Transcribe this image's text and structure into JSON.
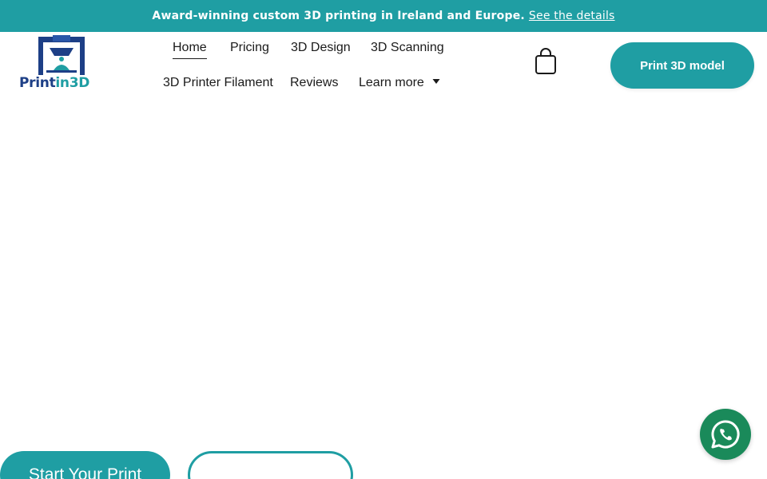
{
  "announcement": {
    "text": "Award-winning custom 3D printing in Ireland and Europe.",
    "link_label": "See the details"
  },
  "logo": {
    "text_part1": "Print",
    "text_part2": "in3D",
    "icon": "3d-printer-icon"
  },
  "nav": {
    "items": [
      {
        "label": "Home",
        "active": true
      },
      {
        "label": "Pricing"
      },
      {
        "label": "3D Design"
      },
      {
        "label": "3D Scanning"
      },
      {
        "label": "3D Printer Filament"
      },
      {
        "label": "Reviews"
      },
      {
        "label": "Learn more",
        "has_dropdown": true
      }
    ]
  },
  "header": {
    "cart_icon": "shopping-bag-icon",
    "cta_label": "Print 3D model"
  },
  "hero": {
    "primary_button": "Start Your Print",
    "secondary_button": ""
  },
  "chat": {
    "icon": "whatsapp-icon"
  },
  "colors": {
    "accent": "#1f9ea3",
    "brand_dark": "#1d3f86",
    "whatsapp": "#1a8a5a"
  }
}
